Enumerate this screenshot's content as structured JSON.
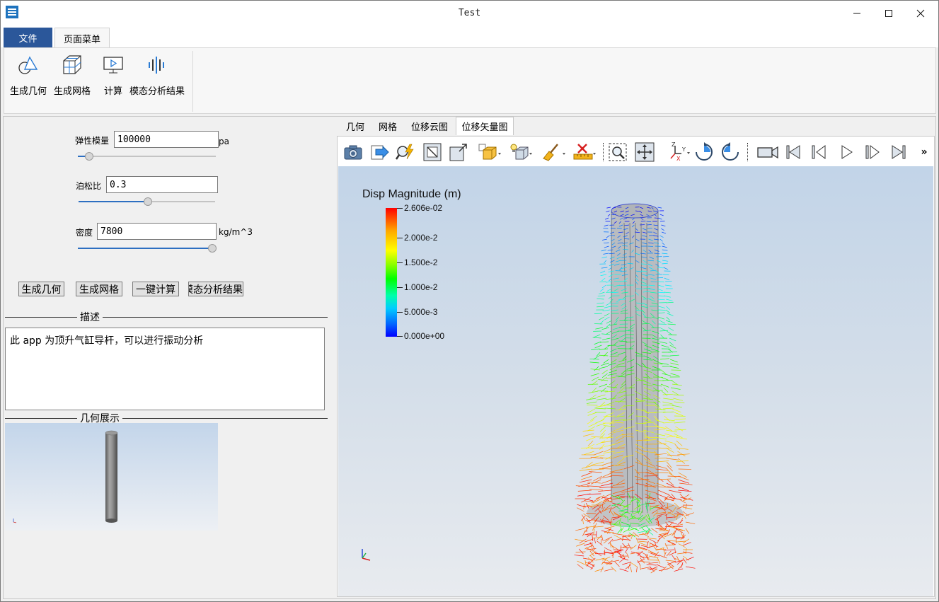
{
  "window": {
    "title": "Test"
  },
  "ribbon": {
    "tabs": [
      "文件",
      "页面菜单"
    ],
    "buttons": [
      "生成几何",
      "生成网格",
      "计算",
      "模态分析结果"
    ]
  },
  "params": {
    "elastic": {
      "label": "弹性模量",
      "value": "100000",
      "unit": "pa"
    },
    "poisson": {
      "label": "泊松比",
      "value": "0.3",
      "unit": ""
    },
    "density": {
      "label": "密度",
      "value": "7800",
      "unit": "kg/m^3"
    }
  },
  "actions": [
    "生成几何",
    "生成网格",
    "一键计算",
    "模态分析结果"
  ],
  "description": {
    "title": "描述",
    "text": "此 app 为顶升气缸导杆，可以进行振动分析"
  },
  "geometry": {
    "title": "几何展示"
  },
  "view_tabs": [
    "几何",
    "网格",
    "位移云图",
    "位移矢量图"
  ],
  "view_tabs_active": "位移矢量图",
  "colorbar": {
    "title": "Disp Magnitude (m)",
    "labels": [
      "2.606e-02",
      "2.000e-2",
      "1.500e-2",
      "1.000e-2",
      "5.000e-3",
      "0.000e+00"
    ],
    "colors": [
      "#ff0000",
      "#ffff00",
      "#00ff00",
      "#00ffff",
      "#0000ff"
    ]
  },
  "toolbar_more": "»",
  "colors": {
    "accent": "#2b579a",
    "slider": "#2d6fc1"
  }
}
